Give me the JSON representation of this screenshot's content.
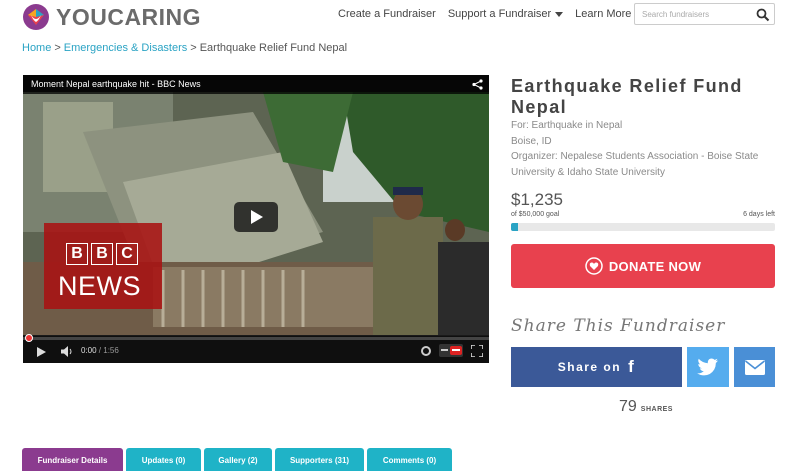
{
  "brand": {
    "name": "YOUCARING"
  },
  "nav": {
    "items": [
      {
        "label": "Create a Fundraiser"
      },
      {
        "label": "Support a Fundraiser"
      },
      {
        "label": "Learn More"
      }
    ]
  },
  "search": {
    "placeholder": "Search fundraisers"
  },
  "breadcrumb": {
    "home": "Home",
    "sep1": ">",
    "category": "Emergencies & Disasters",
    "sep2": ">",
    "current": "Earthquake Relief Fund Nepal"
  },
  "video": {
    "title": "Moment Nepal earthquake hit - BBC News",
    "overlay": {
      "letters": [
        "B",
        "B",
        "C"
      ],
      "word": "NEWS"
    },
    "time_current": "0:00",
    "time_total": " / 1:56",
    "progress_fraction": 0
  },
  "fundraiser": {
    "title": "Earthquake Relief Fund Nepal",
    "for": "For: Earthquake in Nepal",
    "location": "Boise, ID",
    "organizer": "Organizer: Nepalese Students Association - Boise State University & Idaho State University",
    "raised": "$1,235",
    "goal": "of $50,000 goal",
    "days_left": "6 days left",
    "progress_percent": 2.5,
    "donate_label": "DONATE NOW"
  },
  "share": {
    "heading": "Share This Fundraiser",
    "facebook_label": "Share on",
    "facebook_glyph": "f",
    "count": "79",
    "count_label": "SHARES"
  },
  "tabs": [
    {
      "label": "Fundraiser Details",
      "active": true
    },
    {
      "label": "Updates (0)",
      "active": false
    },
    {
      "label": "Gallery (2)",
      "active": false
    },
    {
      "label": "Supporters (31)",
      "active": false
    },
    {
      "label": "Comments (0)",
      "active": false
    }
  ],
  "colors": {
    "accent_teal": "#2aa3c4",
    "donate_red": "#e8414e",
    "facebook_blue": "#3b5998",
    "twitter_blue": "#55acee",
    "mail_blue": "#4a8fd6",
    "tab_active_purple": "#8b3b8f",
    "tab_teal": "#1fb3c7"
  },
  "icons": {
    "logo": "heart-logo-icon",
    "search": "search-icon",
    "share": "share-icon",
    "play": "play-icon",
    "volume": "volume-icon",
    "donate": "heart-icon",
    "twitter": "twitter-icon",
    "mail": "mail-icon"
  }
}
